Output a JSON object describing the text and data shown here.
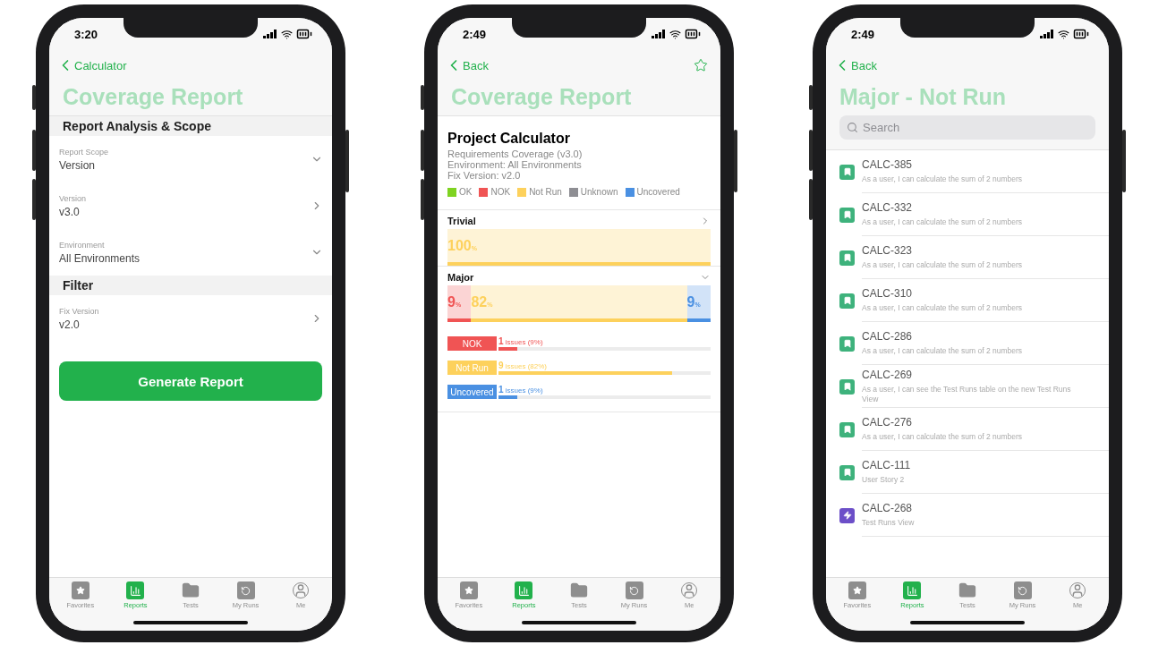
{
  "phones": [
    {
      "kind": "form",
      "time": "3:20",
      "back": "Calculator",
      "title": "Coverage Report",
      "sections": [
        {
          "header": "Report Analysis & Scope",
          "fields": [
            {
              "label": "Report Scope",
              "value": "Version",
              "kind": "dropdown"
            },
            {
              "label": "Version",
              "value": "v3.0",
              "kind": "disclosure"
            },
            {
              "label": "Environment",
              "value": "All Environments",
              "kind": "dropdown"
            }
          ]
        },
        {
          "header": "Filter",
          "fields": [
            {
              "label": "Fix Version",
              "value": "v2.0",
              "kind": "disclosure"
            }
          ]
        }
      ],
      "button": "Generate Report",
      "tabs": [
        {
          "label": "Favorites",
          "selected": false
        },
        {
          "label": "Reports",
          "selected": true
        },
        {
          "label": "Tests",
          "selected": false
        },
        {
          "label": "My Runs",
          "selected": false
        },
        {
          "label": "Me",
          "selected": false
        }
      ]
    },
    {
      "kind": "report",
      "time": "2:49",
      "back": "Back",
      "favorite": false,
      "title": "Coverage Report",
      "project": "Project Calculator",
      "lines": [
        "Requirements Coverage (v3.0)",
        "Environment: All Environments",
        "Fix Version: v2.0"
      ],
      "legend": [
        {
          "label": "OK",
          "color": "#7ed321"
        },
        {
          "label": "NOK",
          "color": "#f05454"
        },
        {
          "label": "Not Run",
          "color": "#fdd15c"
        },
        {
          "label": "Unknown",
          "color": "#8e8e93"
        },
        {
          "label": "Uncovered",
          "color": "#4a90e2"
        }
      ],
      "groups": [
        {
          "name": "Trivial",
          "expanded": false,
          "segments": [
            {
              "percent": "100",
              "unit": "%",
              "color": "#fdd15c"
            }
          ]
        },
        {
          "name": "Major",
          "expanded": true,
          "segments": [
            {
              "percent": "9",
              "unit": "%",
              "color": "#f05454"
            },
            {
              "percent": "82",
              "unit": "%",
              "color": "#fdd15c"
            },
            {
              "percent": "9",
              "unit": "%",
              "color": "#4a90e2"
            }
          ],
          "breakdown": [
            {
              "label": "NOK",
              "color": "#f05454",
              "count": "1",
              "text": "issues (9%)",
              "level": 0.09
            },
            {
              "label": "Not Run",
              "color": "#fdd15c",
              "count": "9",
              "text": "issues (82%)",
              "level": 0.82
            },
            {
              "label": "Uncovered",
              "color": "#4a90e2",
              "count": "1",
              "text": "issues (9%)",
              "level": 0.09
            }
          ]
        }
      ],
      "tabs": [
        {
          "label": "Favorites",
          "selected": false
        },
        {
          "label": "Reports",
          "selected": true
        },
        {
          "label": "Tests",
          "selected": false
        },
        {
          "label": "My Runs",
          "selected": false
        },
        {
          "label": "Me",
          "selected": false
        }
      ]
    },
    {
      "kind": "list",
      "time": "2:49",
      "back": "Back",
      "title": "Major - Not Run",
      "search": {
        "placeholder": "Search"
      },
      "items": [
        {
          "kind": "story",
          "id": "CALC-385",
          "description": "As a user, I can calculate the sum of 2 numbers"
        },
        {
          "kind": "story",
          "id": "CALC-332",
          "description": "As a user, I can calculate the sum of 2 numbers"
        },
        {
          "kind": "story",
          "id": "CALC-323",
          "description": "As a user, I can calculate the sum of 2 numbers"
        },
        {
          "kind": "story",
          "id": "CALC-310",
          "description": "As a user, I can calculate the sum of 2 numbers"
        },
        {
          "kind": "story",
          "id": "CALC-286",
          "description": "As a user, I can calculate the sum of 2 numbers"
        },
        {
          "kind": "story",
          "id": "CALC-269",
          "description": "As a user, I can see the Test Runs table on the new Test Runs View"
        },
        {
          "kind": "story",
          "id": "CALC-276",
          "description": "As a user, I can calculate the sum of 2 numbers"
        },
        {
          "kind": "story",
          "id": "CALC-111",
          "description": "User Story 2"
        },
        {
          "kind": "test",
          "id": "CALC-268",
          "description": "Test Runs View"
        }
      ],
      "tabs": [
        {
          "label": "Favorites",
          "selected": false
        },
        {
          "label": "Reports",
          "selected": true
        },
        {
          "label": "Tests",
          "selected": false
        },
        {
          "label": "My Runs",
          "selected": false
        },
        {
          "label": "Me",
          "selected": false
        }
      ]
    }
  ]
}
